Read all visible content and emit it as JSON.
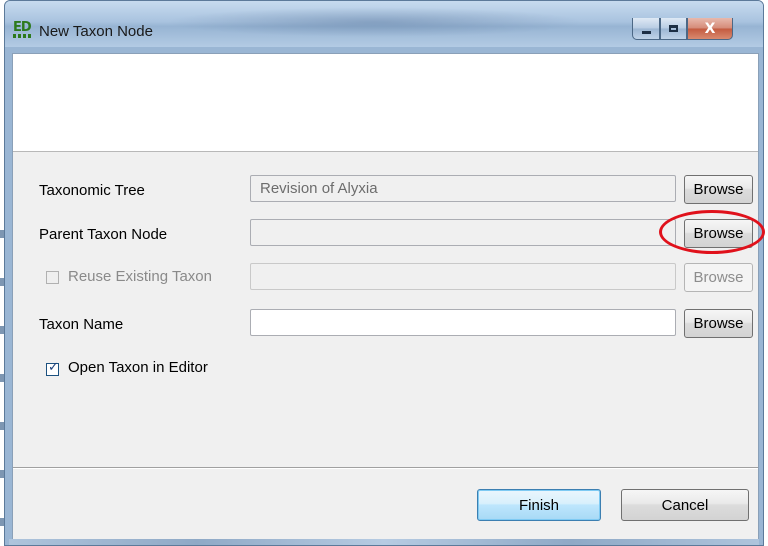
{
  "window": {
    "title": "New Taxon Node",
    "app_icon_letters": "ED",
    "close_glyph": "X"
  },
  "form": {
    "taxonomic_tree": {
      "label": "Taxonomic Tree",
      "value": "Revision of Alyxia",
      "browse_label": "Browse",
      "enabled": false
    },
    "parent_taxon_node": {
      "label": "Parent Taxon Node",
      "value": "",
      "browse_label": "Browse",
      "enabled": false
    },
    "reuse_existing_taxon": {
      "label": "Reuse Existing Taxon",
      "checked": false,
      "value": "",
      "browse_label": "Browse",
      "enabled": false
    },
    "taxon_name": {
      "label": "Taxon Name",
      "value": "",
      "browse_label": "Browse",
      "enabled": true
    },
    "open_taxon_in_editor": {
      "label": "Open Taxon in Editor",
      "checked": true
    }
  },
  "footer": {
    "finish_label": "Finish",
    "cancel_label": "Cancel"
  },
  "annotation": {
    "highlight_color": "#e0111b",
    "highlight_target": "parent-taxon-browse-button"
  },
  "icons": [
    "app-icon",
    "minimize-icon",
    "maximize-icon",
    "close-icon",
    "checkmark-icon"
  ]
}
